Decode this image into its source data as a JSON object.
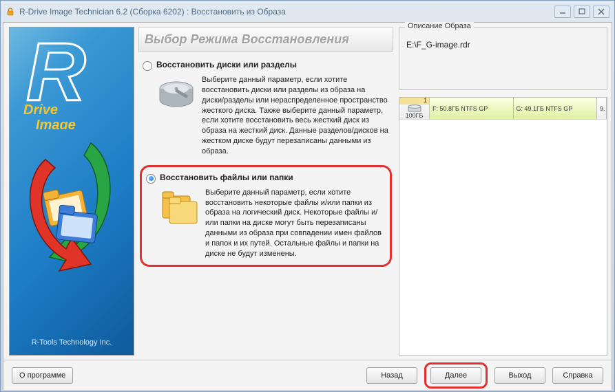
{
  "window": {
    "title": "R-Drive Image Technician 6.2 (Сборка 6202) : Восстановить из Образа"
  },
  "sidebar": {
    "brand_line1": "Drive",
    "brand_line2": "Image",
    "footer": "R-Tools Technology Inc."
  },
  "heading": "Выбор Режима Восстановления",
  "options": {
    "opt1": {
      "label": "Восстановить диски или разделы",
      "desc": "Выберите данный параметр, если хотите восстановить диски или разделы из образа на диски/разделы или нераспределенное пространство жесткого диска. Также выберите данный параметр, если хотите восстановить весь жесткий диск из образа на жесткий диск. Данные разделов/дисков на жестком диске будут перезаписаны данными из образа.",
      "selected": false
    },
    "opt2": {
      "label": "Восстановить файлы или папки",
      "desc": "Выберите данный параметр, если хотите восстановить некоторые файлы и/или папки из образа на логический диск. Некоторые файлы и/или папки на диске могут быть перезаписаны данными из образа при совпадении имен файлов и папок и их путей. Остальные файлы и папки на диске не будут изменены.",
      "selected": true
    }
  },
  "image_desc": {
    "legend": "Описание Образа",
    "path": "E:\\F_G-image.rdr"
  },
  "disk": {
    "index": "1",
    "size": "100ГБ",
    "partitions": [
      {
        "label": "F: 50.8ГБ NTFS GP"
      },
      {
        "label": "G: 49.1ГБ NTFS GP"
      },
      {
        "label": "9."
      }
    ]
  },
  "buttons": {
    "about": "О программе",
    "back": "Назад",
    "next": "Далее",
    "exit": "Выход",
    "help": "Справка"
  }
}
